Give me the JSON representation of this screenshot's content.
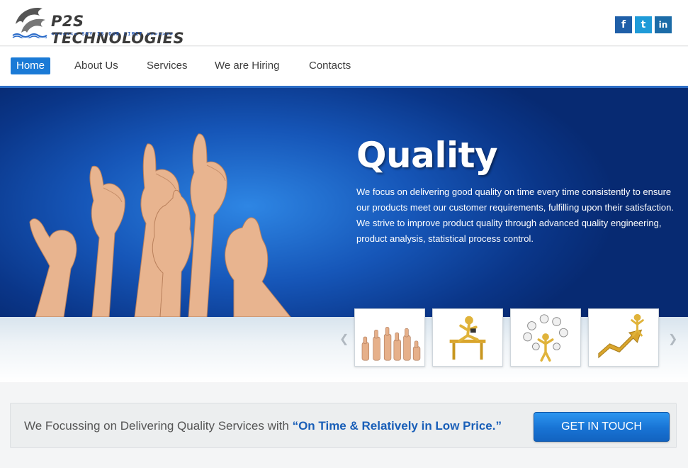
{
  "header": {
    "logo_title": "P2S TECHNOLOGIES",
    "logo_tagline": "<<<<<<< SKY IS OUR LIMIT >>>>>>>",
    "social": [
      {
        "name": "facebook",
        "glyph": "f",
        "color": "#1f5fa8"
      },
      {
        "name": "twitter",
        "glyph": "t",
        "color": "#1f9bd8"
      },
      {
        "name": "linkedin",
        "glyph": "in",
        "color": "#1c6ca8"
      }
    ]
  },
  "nav": {
    "items": [
      {
        "label": "Home",
        "active": true
      },
      {
        "label": "About Us",
        "active": false
      },
      {
        "label": "Services",
        "active": false
      },
      {
        "label": "We are Hiring",
        "active": false
      },
      {
        "label": "Contacts",
        "active": false
      }
    ]
  },
  "hero": {
    "title": "Quality",
    "text": "We focus on delivering good quality on time every time consistently to ensure our products meet our customer requirements, fulfilling upon their satisfaction. We strive to improve product quality through advanced quality engineering, product analysis, statistical process control.",
    "prev_arrow": "❮",
    "next_arrow": "❯"
  },
  "cta": {
    "text_plain": "We Focussing on Delivering Quality Services with ",
    "text_highlight": "“On Time & Relatively in Low Price.”",
    "button_label": "GET IN TOUCH"
  },
  "colors": {
    "accent": "#1a7ad6",
    "hero_blue": "#1656b8",
    "highlight_text": "#1a5fb8"
  }
}
